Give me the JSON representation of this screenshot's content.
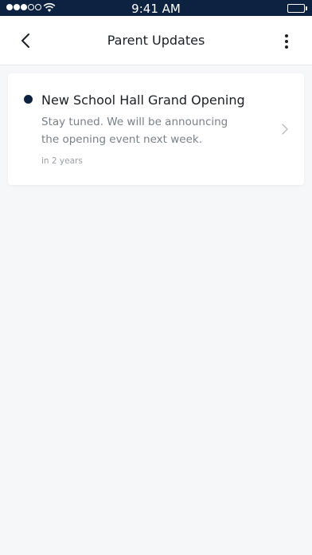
{
  "status_bar": {
    "time": "9:41 AM",
    "signal_icon": "signal-dots-icon",
    "wifi_icon": "wifi-icon",
    "battery_icon": "battery-icon"
  },
  "nav": {
    "title": "Parent Updates",
    "back_icon": "chevron-left-icon",
    "more_icon": "more-vertical-icon"
  },
  "updates": [
    {
      "title": "New School Hall Grand Opening",
      "body": "Stay tuned. We will be announcing the opening event next week.",
      "time": "in 2 years",
      "unread": true
    }
  ],
  "colors": {
    "status_bar_bg": "#0d2240",
    "unread_dot": "#0d2240",
    "page_bg": "#f6f7f9"
  }
}
